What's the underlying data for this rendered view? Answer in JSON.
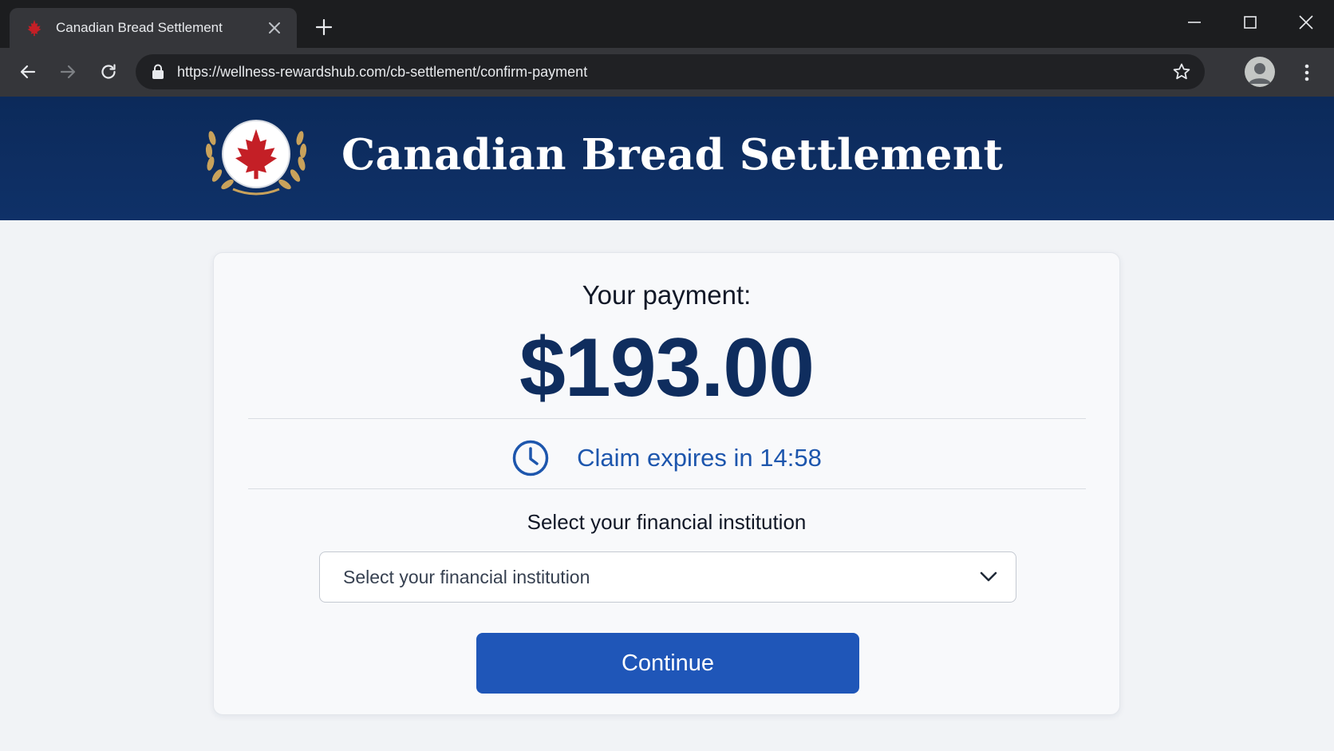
{
  "browser": {
    "tab_title": "Canadian Bread Settlement",
    "url": "https://wellness-rewardshub.com/cb-settlement/confirm-payment",
    "icons": {
      "favicon": "maple-leaf-icon",
      "close": "close-icon",
      "new_tab": "plus-icon",
      "minimize": "minimize-icon",
      "maximize": "maximize-icon",
      "window_close": "close-icon",
      "back": "arrow-left-icon",
      "forward": "arrow-right-icon",
      "reload": "reload-icon",
      "lock": "lock-icon",
      "bookmark": "star-icon",
      "profile": "avatar-icon",
      "menu": "kebab-menu-icon"
    }
  },
  "header": {
    "title": "Canadian Bread Settlement",
    "logo": "maple-leaf-wheat-emblem",
    "colors": {
      "background": "#0c2a5a",
      "leaf": "#c41f26",
      "wheat": "#c9a25b"
    }
  },
  "payment": {
    "label": "Your payment:",
    "amount": "$193.00"
  },
  "timer": {
    "text": "Claim expires in 14:58",
    "icon": "clock-icon"
  },
  "institution": {
    "label": "Select your financial institution",
    "selected": "Select your financial institution",
    "icon": "chevron-down-icon"
  },
  "continue_button": {
    "label": "Continue"
  },
  "colors": {
    "accent": "#1f56b8",
    "amount": "#0f2d5e",
    "timer": "#1d56ad"
  }
}
